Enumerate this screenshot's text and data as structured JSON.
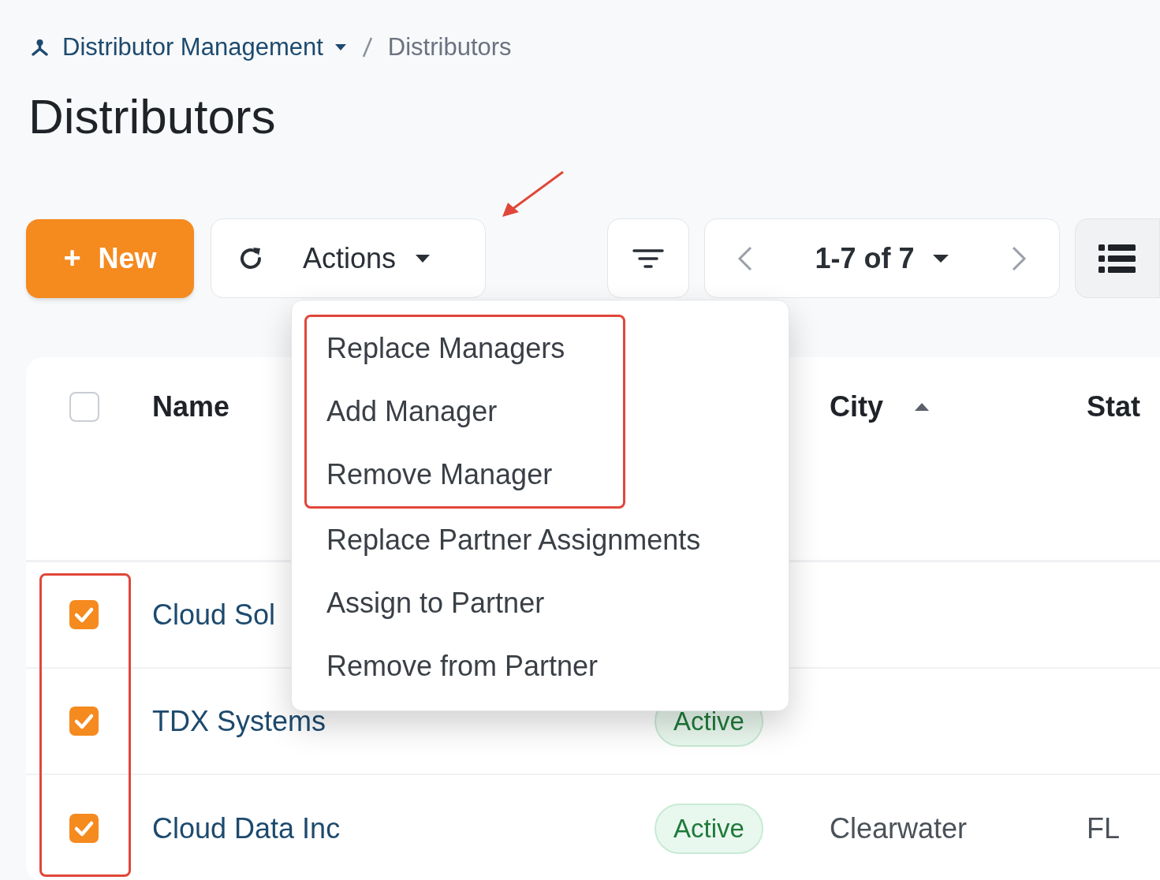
{
  "breadcrumb": {
    "parent": "Distributor Management",
    "current": "Distributors"
  },
  "title": "Distributors",
  "toolbar": {
    "new_icon": "+",
    "new_label": "New",
    "actions_label": "Actions",
    "pager": "1-7 of 7",
    "actions_arrow": true
  },
  "actions_menu": {
    "expanded": true,
    "items": [
      {
        "label": "Replace Managers",
        "highlighted": true
      },
      {
        "label": "Add Manager",
        "highlighted": true
      },
      {
        "label": "Remove Manager",
        "highlighted": true
      },
      {
        "label": "Replace Partner Assignments",
        "highlighted": false
      },
      {
        "label": "Assign to Partner",
        "highlighted": false
      },
      {
        "label": "Remove from Partner",
        "highlighted": false
      }
    ]
  },
  "table": {
    "select_all_checked": false,
    "headers": {
      "name": "Name",
      "city": "City",
      "state": "Stat"
    },
    "city_sort_ascending": true,
    "rows": [
      {
        "checked": true,
        "highlighted": true,
        "name": "Cloud Sol"
      },
      {
        "checked": true,
        "highlighted": true,
        "name": "TDX Systems",
        "status": "Active"
      },
      {
        "checked": true,
        "highlighted": true,
        "name": "Cloud Data Inc",
        "status": "Active",
        "city": "Clearwater",
        "state": "FL"
      }
    ]
  }
}
